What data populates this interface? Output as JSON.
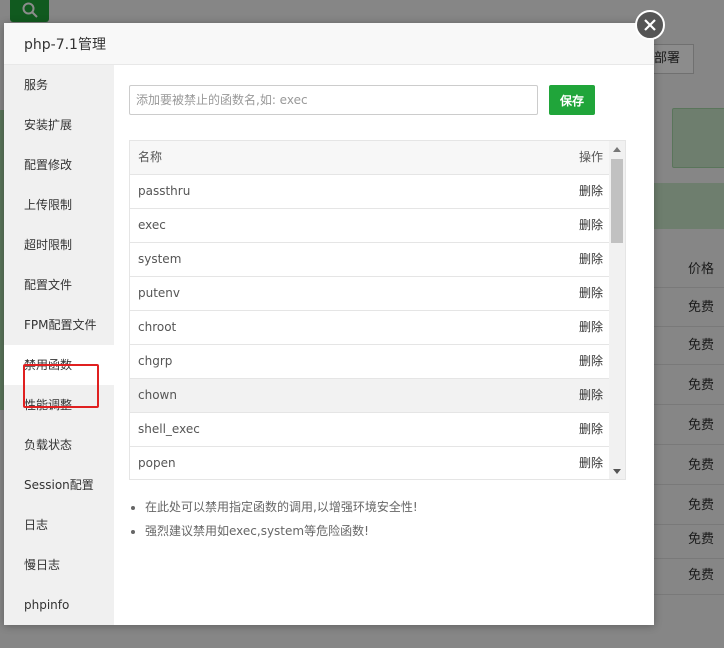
{
  "background": {
    "deploy_label": "部署",
    "price_header": "价格",
    "free_labels": [
      "免费",
      "免费",
      "免费",
      "免费",
      "免费",
      "免费",
      "免费",
      "免费"
    ]
  },
  "modal": {
    "title": "php-7.1管理",
    "sidebar": [
      {
        "label": "服务"
      },
      {
        "label": "安装扩展"
      },
      {
        "label": "配置修改"
      },
      {
        "label": "上传限制"
      },
      {
        "label": "超时限制"
      },
      {
        "label": "配置文件"
      },
      {
        "label": "FPM配置文件"
      },
      {
        "label": "禁用函数"
      },
      {
        "label": "性能调整"
      },
      {
        "label": "负载状态"
      },
      {
        "label": "Session配置"
      },
      {
        "label": "日志"
      },
      {
        "label": "慢日志"
      },
      {
        "label": "phpinfo"
      }
    ],
    "active_index": 7,
    "input": {
      "placeholder": "添加要被禁止的函数名,如: exec",
      "value": ""
    },
    "save_label": "保存",
    "table": {
      "headers": {
        "name": "名称",
        "action": "操作"
      },
      "rows": [
        {
          "name": "passthru",
          "action": "删除"
        },
        {
          "name": "exec",
          "action": "删除"
        },
        {
          "name": "system",
          "action": "删除"
        },
        {
          "name": "putenv",
          "action": "删除"
        },
        {
          "name": "chroot",
          "action": "删除"
        },
        {
          "name": "chgrp",
          "action": "删除"
        },
        {
          "name": "chown",
          "action": "删除"
        },
        {
          "name": "shell_exec",
          "action": "删除"
        },
        {
          "name": "popen",
          "action": "删除"
        }
      ],
      "highlight_row": 6
    },
    "tips": [
      "在此处可以禁用指定函数的调用,以增强环境安全性!",
      "强烈建议禁用如exec,system等危险函数!"
    ]
  },
  "colors": {
    "accent": "#20a53a",
    "highlight_box": "#e02020",
    "close_bg": "#555555"
  }
}
